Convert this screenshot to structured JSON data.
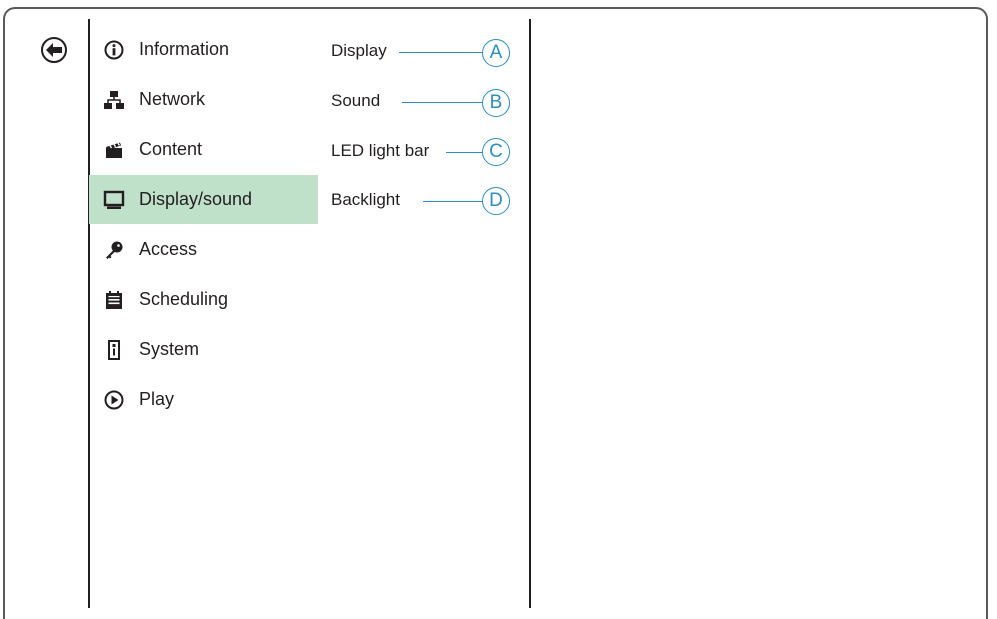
{
  "menu": {
    "back_icon": "arrow-left-circle-icon",
    "items": [
      {
        "label": "Information",
        "icon": "info-icon"
      },
      {
        "label": "Network",
        "icon": "network-icon"
      },
      {
        "label": "Content",
        "icon": "clapperboard-icon"
      },
      {
        "label": "Display/sound",
        "icon": "monitor-icon",
        "active": true
      },
      {
        "label": "Access",
        "icon": "key-icon"
      },
      {
        "label": "Scheduling",
        "icon": "calendar-icon"
      },
      {
        "label": "System",
        "icon": "system-icon"
      },
      {
        "label": "Play",
        "icon": "play-icon"
      }
    ],
    "active_color": "#bfe0c9"
  },
  "submenu": {
    "items": [
      {
        "label": "Display",
        "callout": "A"
      },
      {
        "label": "Sound",
        "callout": "B"
      },
      {
        "label": "LED light bar",
        "callout": "C"
      },
      {
        "label": "Backlight",
        "callout": "D"
      }
    ],
    "callout_color": "#2a8ec9"
  }
}
